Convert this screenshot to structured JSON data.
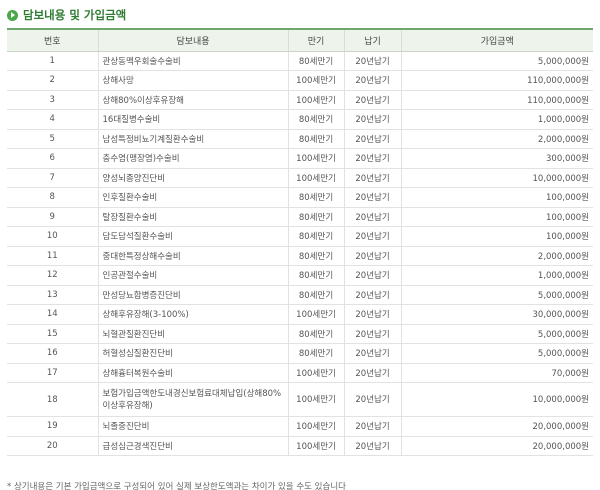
{
  "section": {
    "title": "담보내용 및 가입금액",
    "bullet_icon": "circle-arrow-icon",
    "accent_color": "#4aa84a"
  },
  "table": {
    "headers": {
      "no": "번호",
      "coverage": "담보내용",
      "maturity": "만기",
      "payment": "납기",
      "amount": "가입금액"
    },
    "rows": [
      {
        "no": "1",
        "coverage": "관상동맥우회술수술비",
        "maturity": "80세만기",
        "payment": "20년납기",
        "amount": "5,000,000원"
      },
      {
        "no": "2",
        "coverage": "상해사망",
        "maturity": "100세만기",
        "payment": "20년납기",
        "amount": "110,000,000원"
      },
      {
        "no": "3",
        "coverage": "상해80%이상후유장해",
        "maturity": "100세만기",
        "payment": "20년납기",
        "amount": "110,000,000원"
      },
      {
        "no": "4",
        "coverage": "16대질병수술비",
        "maturity": "80세만기",
        "payment": "20년납기",
        "amount": "1,000,000원"
      },
      {
        "no": "5",
        "coverage": "남성특정비뇨기계질환수술비",
        "maturity": "80세만기",
        "payment": "20년납기",
        "amount": "2,000,000원"
      },
      {
        "no": "6",
        "coverage": "충수염(맹장염)수술비",
        "maturity": "100세만기",
        "payment": "20년납기",
        "amount": "300,000원"
      },
      {
        "no": "7",
        "coverage": "양성뇌종양진단비",
        "maturity": "100세만기",
        "payment": "20년납기",
        "amount": "10,000,000원"
      },
      {
        "no": "8",
        "coverage": "인후질환수술비",
        "maturity": "80세만기",
        "payment": "20년납기",
        "amount": "100,000원"
      },
      {
        "no": "9",
        "coverage": "탈장질환수술비",
        "maturity": "80세만기",
        "payment": "20년납기",
        "amount": "100,000원"
      },
      {
        "no": "10",
        "coverage": "담도담석질환수술비",
        "maturity": "80세만기",
        "payment": "20년납기",
        "amount": "100,000원"
      },
      {
        "no": "11",
        "coverage": "중대한특정상해수술비",
        "maturity": "80세만기",
        "payment": "20년납기",
        "amount": "2,000,000원"
      },
      {
        "no": "12",
        "coverage": "인공관절수술비",
        "maturity": "80세만기",
        "payment": "20년납기",
        "amount": "1,000,000원"
      },
      {
        "no": "13",
        "coverage": "만성당뇨합병증진단비",
        "maturity": "80세만기",
        "payment": "20년납기",
        "amount": "5,000,000원"
      },
      {
        "no": "14",
        "coverage": "상해후유장해(3-100%)",
        "maturity": "100세만기",
        "payment": "20년납기",
        "amount": "30,000,000원"
      },
      {
        "no": "15",
        "coverage": "뇌혈관질환진단비",
        "maturity": "80세만기",
        "payment": "20년납기",
        "amount": "5,000,000원"
      },
      {
        "no": "16",
        "coverage": "허혈성심질환진단비",
        "maturity": "80세만기",
        "payment": "20년납기",
        "amount": "5,000,000원"
      },
      {
        "no": "17",
        "coverage": "상해흉터복원수술비",
        "maturity": "100세만기",
        "payment": "20년납기",
        "amount": "70,000원"
      },
      {
        "no": "18",
        "coverage": "보험가입금액한도내경신보험료대체납입(상해80%이상후유장해)",
        "maturity": "100세만기",
        "payment": "20년납기",
        "amount": "10,000,000원"
      },
      {
        "no": "19",
        "coverage": "뇌졸중진단비",
        "maturity": "100세만기",
        "payment": "20년납기",
        "amount": "20,000,000원"
      },
      {
        "no": "20",
        "coverage": "급성심근경색진단비",
        "maturity": "100세만기",
        "payment": "20년납기",
        "amount": "20,000,000원"
      }
    ]
  },
  "footnote": "* 상기내용은 기본 가입금액으로 구성되어 있어 실제 보상한도액과는 차이가 있을 수도 있습니다"
}
